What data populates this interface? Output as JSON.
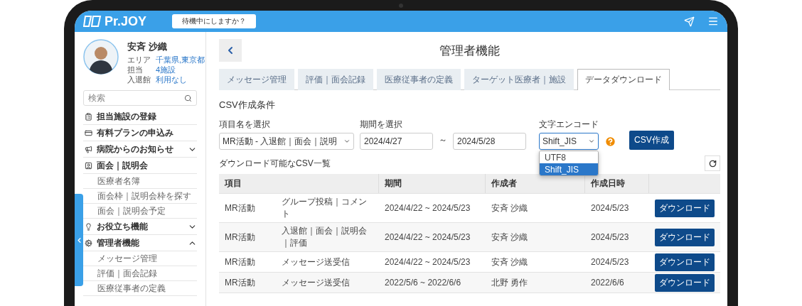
{
  "header": {
    "logo": "Pr.JOY",
    "status_button": "待機中にしますか？"
  },
  "profile": {
    "name": "安斉 沙織",
    "fields": [
      {
        "label": "エリア",
        "value": "千葉県,東京都"
      },
      {
        "label": "担当",
        "value": "4施設"
      },
      {
        "label": "入退館",
        "value": "利用なし"
      }
    ]
  },
  "sidebar": {
    "search": {
      "placeholder": "検索"
    },
    "items": [
      {
        "label": "担当施設の登録",
        "kind": "link"
      },
      {
        "label": "有料プランの申込み",
        "kind": "link"
      },
      {
        "label": "病院からのお知らせ",
        "kind": "group",
        "expanded": false
      },
      {
        "label": "面会｜説明会",
        "kind": "link",
        "children": [
          {
            "label": "医療者名簿"
          },
          {
            "label": "面会枠｜説明会枠を探す"
          },
          {
            "label": "面会｜説明会予定"
          }
        ]
      },
      {
        "label": "お役立ち機能",
        "kind": "group",
        "expanded": false
      },
      {
        "label": "管理者機能",
        "kind": "group",
        "expanded": true,
        "children": [
          {
            "label": "メッセージ管理"
          },
          {
            "label": "評価｜面会記録"
          },
          {
            "label": "医療従事者の定義"
          }
        ]
      }
    ]
  },
  "page": {
    "title": "管理者機能",
    "tabs": [
      {
        "label": "メッセージ管理",
        "selected": false
      },
      {
        "label": "評価｜面会記録",
        "selected": false
      },
      {
        "label": "医療従事者の定義",
        "selected": false
      },
      {
        "label": "ターゲット医療者｜施設",
        "selected": false
      },
      {
        "label": "データダウンロード",
        "selected": true
      }
    ],
    "conditions": {
      "title": "CSV作成条件",
      "item_select": {
        "label": "項目名を選択",
        "value": "MR活動 - 入退館｜面会｜説明"
      },
      "period": {
        "label": "期間を選択",
        "from": "2024/4/27",
        "separator": "～",
        "to": "2024/5/28"
      },
      "encoding": {
        "label": "文字エンコード",
        "value": "Shift_JIS",
        "options": [
          {
            "label": "UTF8",
            "selected": false
          },
          {
            "label": "Shift_JIS",
            "selected": true
          }
        ]
      },
      "create_button": "CSV作成"
    },
    "list": {
      "title": "ダウンロード可能なCSV一覧",
      "columns": [
        "項目",
        "期間",
        "作成者",
        "作成日時"
      ],
      "rows": [
        {
          "category": "MR活動",
          "item": "グループ投稿｜コメント",
          "period": "2024/4/22 ~ 2024/5/23",
          "author": "安斉 沙織",
          "date": "2024/5/23",
          "action": "ダウンロード"
        },
        {
          "category": "MR活動",
          "item": "入退館｜面会｜説明会｜評価",
          "period": "2024/4/22 ~ 2024/5/23",
          "author": "安斉 沙織",
          "date": "2024/5/23",
          "action": "ダウンロード"
        },
        {
          "category": "MR活動",
          "item": "メッセージ送受信",
          "period": "2024/4/22 ~ 2024/5/23",
          "author": "安斉 沙織",
          "date": "2024/5/23",
          "action": "ダウンロード"
        },
        {
          "category": "MR活動",
          "item": "メッセージ送受信",
          "period": "2022/5/6 ~ 2022/6/6",
          "author": "北野 勇作",
          "date": "2022/6/6",
          "action": "ダウンロード"
        }
      ]
    }
  }
}
